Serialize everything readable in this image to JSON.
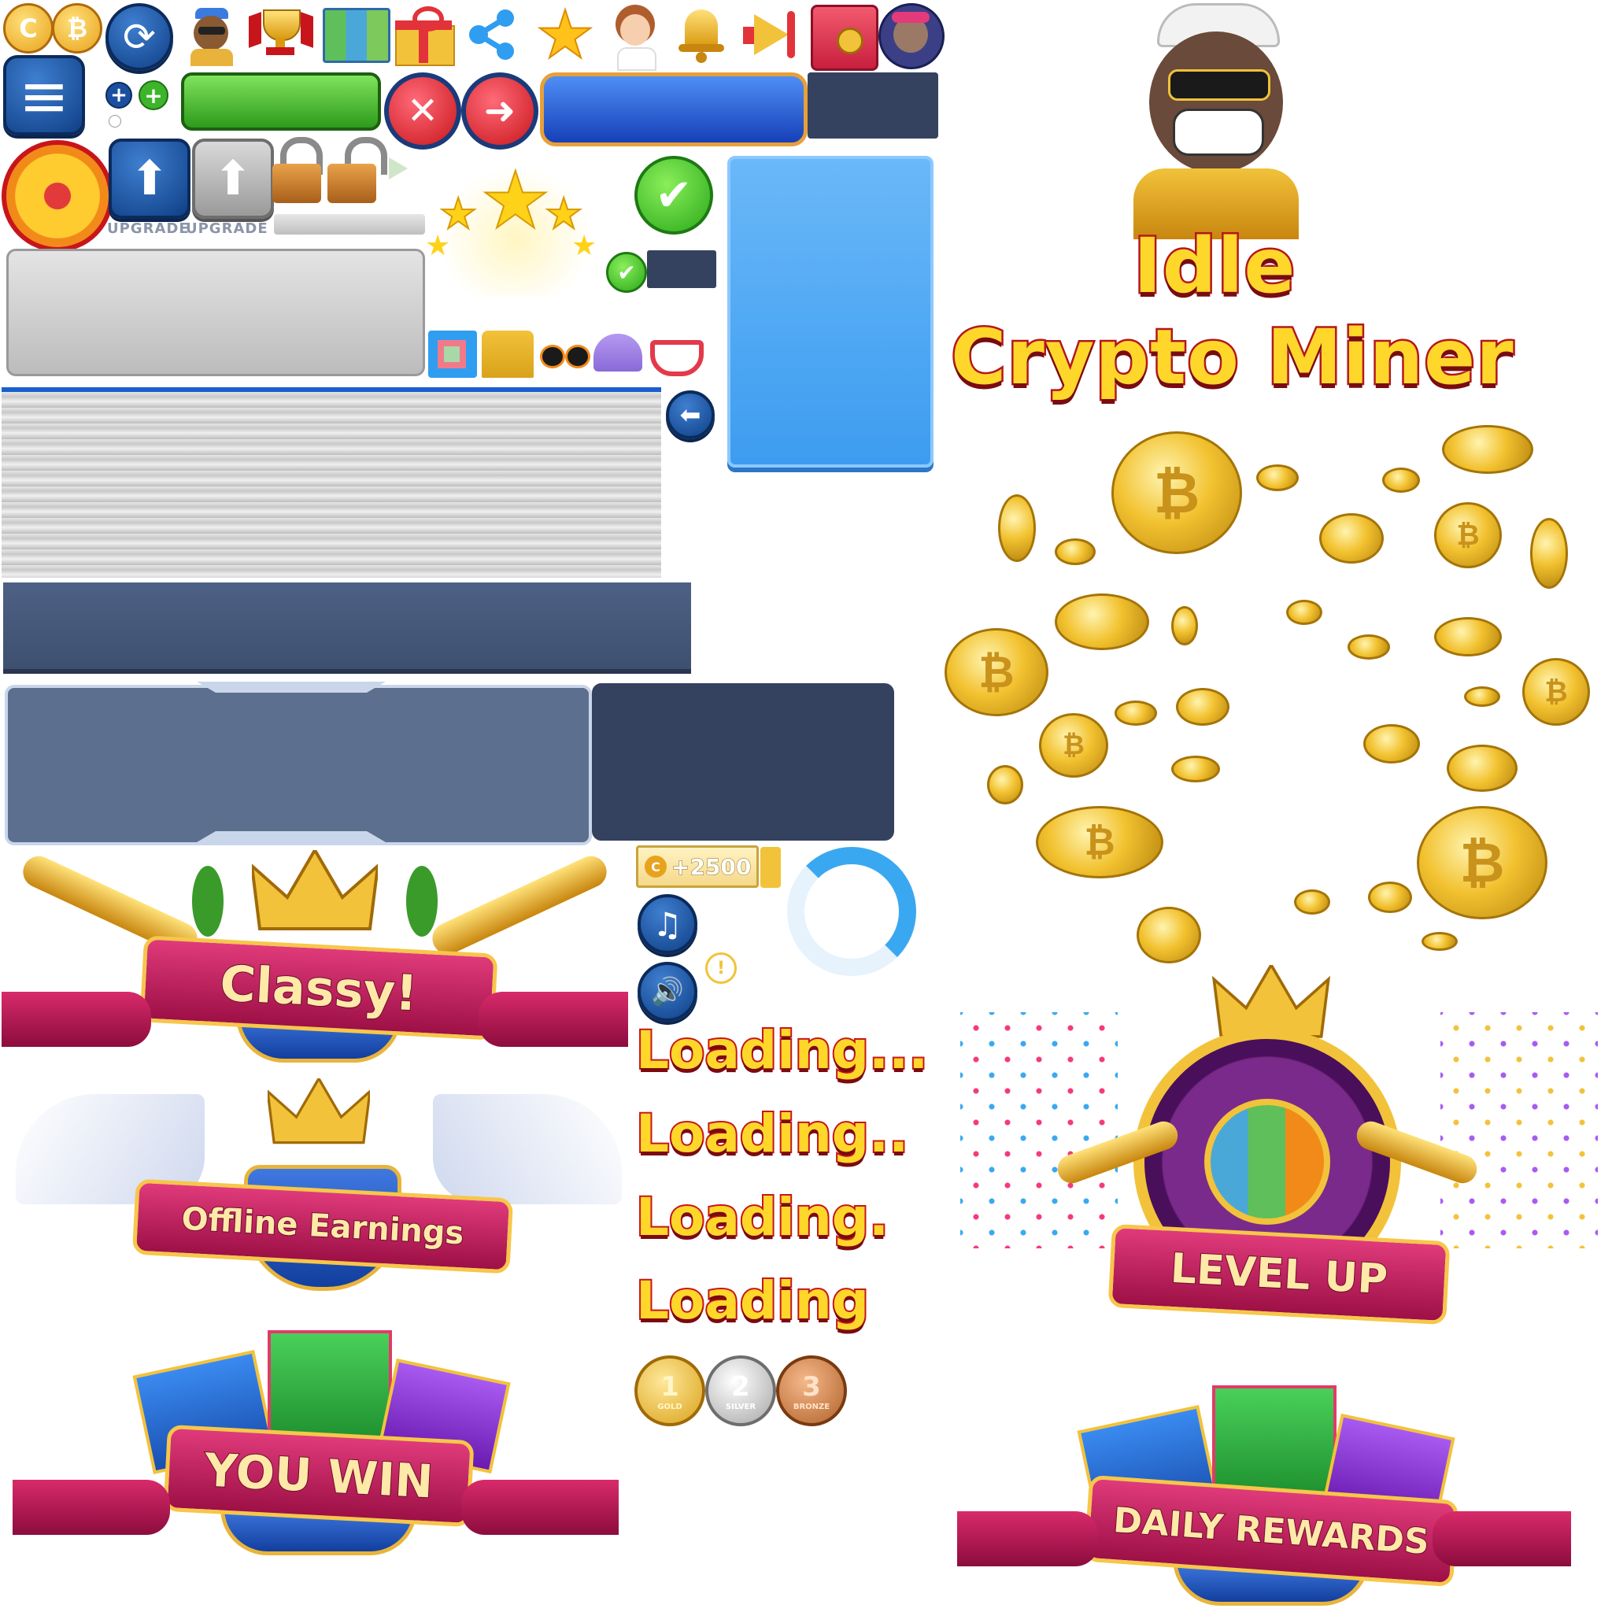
{
  "title": {
    "line1": "Idle",
    "line2": "Crypto Miner"
  },
  "banners": {
    "classy": "Classy!",
    "offline": "Offline Earnings",
    "you_win": "YOU WIN",
    "level_up": "LEVEL UP",
    "daily_rewards": "DAILY REWARDS"
  },
  "upgrade": {
    "label1": "UPGRADE",
    "label2": "UPGRADE"
  },
  "reward_chip": {
    "value": "+2500",
    "coin_letter": "C"
  },
  "loading": {
    "l3": "Loading...",
    "l2": "Loading..",
    "l1": "Loading.",
    "l0": "Loading"
  },
  "medals": {
    "gold": {
      "number": "1",
      "label": "GOLD"
    },
    "silver": {
      "number": "2",
      "label": "SILVER"
    },
    "bronze": {
      "number": "3",
      "label": "BRONZE"
    }
  },
  "glyphs": {
    "coin_c": "C",
    "bitcoin": "₿",
    "plus": "+",
    "close": "✕",
    "arrow_right": "➜",
    "arrow_up": "⬆",
    "arrow_left": "⬅",
    "check": "✔",
    "music": "♫",
    "speaker": "🔊",
    "alert": "!",
    "share": "⋖",
    "star": "★",
    "menu": "≡",
    "refresh": "⟳",
    "bell": "🔔",
    "megaphone": "📣"
  },
  "colors": {
    "gold": "#ffd72a",
    "red_outline": "#c8151b",
    "ribbon_pink": "#c4185a",
    "blue_button": "#1a4fa0",
    "green_bar": "#3cb52a",
    "panel_slate": "#5c6f8f",
    "panel_dark": "#34425f",
    "light_blue_panel": "#5fb0f5"
  }
}
